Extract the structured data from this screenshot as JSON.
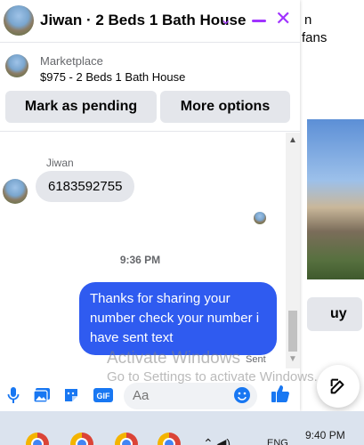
{
  "background": {
    "text_line1": "n",
    "text_line2": "fans",
    "buy_partial": "uy"
  },
  "chat": {
    "title": "Jiwan · 2 Beds 1 Bath House",
    "accent_color": "#a033ff"
  },
  "marketplace": {
    "label": "Marketplace",
    "listing": "$975 - 2 Beds 1 Bath House",
    "mark_pending_label": "Mark as pending",
    "more_options_label": "More options"
  },
  "messages": {
    "sender_name": "Jiwan",
    "incoming_text": "6183592755",
    "timestamp": "9:36 PM",
    "outgoing_text": "Thanks for sharing your number check your number i have sent text",
    "status": "Sent",
    "outgoing_color": "#2f5bf0"
  },
  "composer": {
    "placeholder": "Aa",
    "icons": [
      "microphone-icon",
      "photo-icon",
      "sticker-icon",
      "gif-icon",
      "emoji-icon",
      "thumbs-up-icon"
    ],
    "gif_label": "GIF"
  },
  "watermark": {
    "line1": "Activate Windows",
    "line2": "Go to Settings to activate Windows."
  },
  "taskbar": {
    "language": "ENG",
    "time": "9:40 PM",
    "chrome_count": 4
  }
}
